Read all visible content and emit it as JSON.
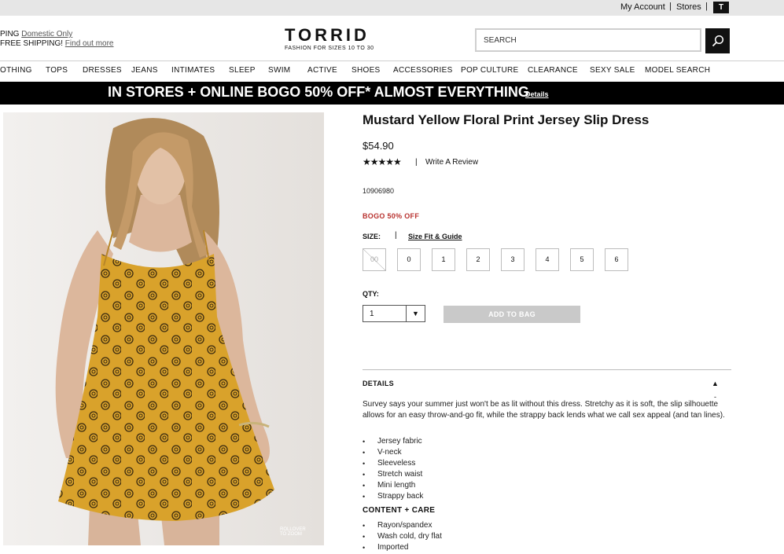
{
  "utility": {
    "my_account": "My Account",
    "sep": "|",
    "stores": "Stores",
    "badge": "T"
  },
  "header": {
    "shipping_line1_prefix": "PING",
    "shipping_line1_link": "Domestic Only",
    "shipping_line2_prefix": "FREE SHIPPING!",
    "shipping_line2_link": "Find out more",
    "logo": "TORRID",
    "tagline": "FASHION FOR SIZES 10 TO 30",
    "search_placeholder": "SEARCH",
    "search_icon": "search-icon"
  },
  "nav": {
    "items": [
      "OTHING",
      "TOPS",
      "DRESSES",
      "JEANS",
      "INTIMATES",
      "SLEEP",
      "SWIM",
      "ACTIVE",
      "SHOES",
      "ACCESSORIES",
      "POP CULTURE",
      "CLEARANCE",
      "SEXY SALE",
      "MODEL SEARCH"
    ]
  },
  "promo": {
    "text": "IN STORES + ONLINE BOGO 50% OFF* ALMOST EVERYTHING",
    "link": "Details"
  },
  "image": {
    "zoom_hint_line1": "ROLLOVER",
    "zoom_hint_line2": "TO ZOOM",
    "dress_color": "#d9a22b",
    "bg_color": "#ece9e6"
  },
  "product": {
    "title": "Mustard Yellow Floral Print Jersey Slip Dress",
    "price": "$54.90",
    "stars": "★★★★★",
    "review_sep": "|",
    "write_review": "Write A Review",
    "sku": "10906980",
    "promo_badge": "BOGO 50% OFF",
    "promo_color": "#b8322f",
    "size_label": "SIZE:",
    "size_sep": "|",
    "size_fit_link": "Size Fit & Guide",
    "sizes": [
      "00",
      "0",
      "1",
      "2",
      "3",
      "4",
      "5",
      "6"
    ],
    "unavailable_sizes": [
      "00"
    ],
    "qty_label": "QTY:",
    "qty_value": "1",
    "qty_arrow": "▼",
    "add_to_bag": "ADD TO BAG"
  },
  "details": {
    "header": "DETAILS",
    "collapse_icon": "▲",
    "dash": "-",
    "description": "Survey says your summer just won't be as lit without this dress. Stretchy as it is soft, the slip silhouette allows for an easy throw-and-go fit, while the strappy back lends what we call sex appeal (and tan lines).",
    "features": [
      "Jersey fabric",
      "V-neck",
      "Sleeveless",
      "Stretch waist",
      "Mini length",
      "Strappy back"
    ],
    "content_header": "CONTENT + CARE",
    "care": [
      "Rayon/spandex",
      "Wash cold, dry flat",
      "Imported"
    ]
  }
}
